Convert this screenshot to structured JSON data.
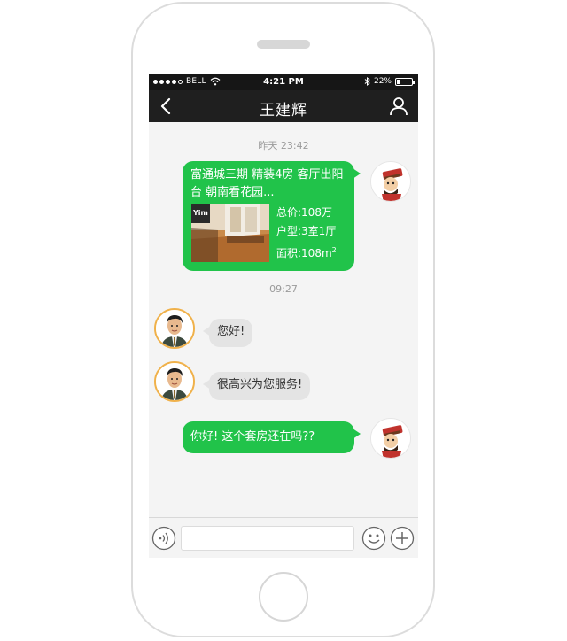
{
  "statusbar": {
    "carrier": "BELL",
    "time": "4:21 PM",
    "battery": "22%",
    "battery_level": 0.22
  },
  "header": {
    "title": "王建辉"
  },
  "timestamps": {
    "first": "昨天  23:42",
    "second": "09:27"
  },
  "messages": {
    "listing_card": {
      "title": "富通城三期 精装4房 客厅出阳台 朝南看花园...",
      "image_logo": "Yim",
      "price": "总价:108万",
      "layout": "户型:3室1厅",
      "area": "面积:108m",
      "area_unit_sup": "2"
    },
    "agent_1": "您好!",
    "agent_2": "很高兴为您服务!",
    "user_1": "你好!  这个套房还在吗??"
  },
  "input": {
    "value": "",
    "placeholder": ""
  },
  "colors": {
    "bubble_green": "#21c34a",
    "bubble_gray": "#e4e4e4",
    "nav_bar": "#1f1f1f",
    "agent_ring": "#f0b14a"
  },
  "icons": {
    "back": "chevron-left-icon",
    "profile": "person-icon",
    "voice": "voice-icon",
    "emoji": "smiley-icon",
    "add": "plus-icon"
  }
}
